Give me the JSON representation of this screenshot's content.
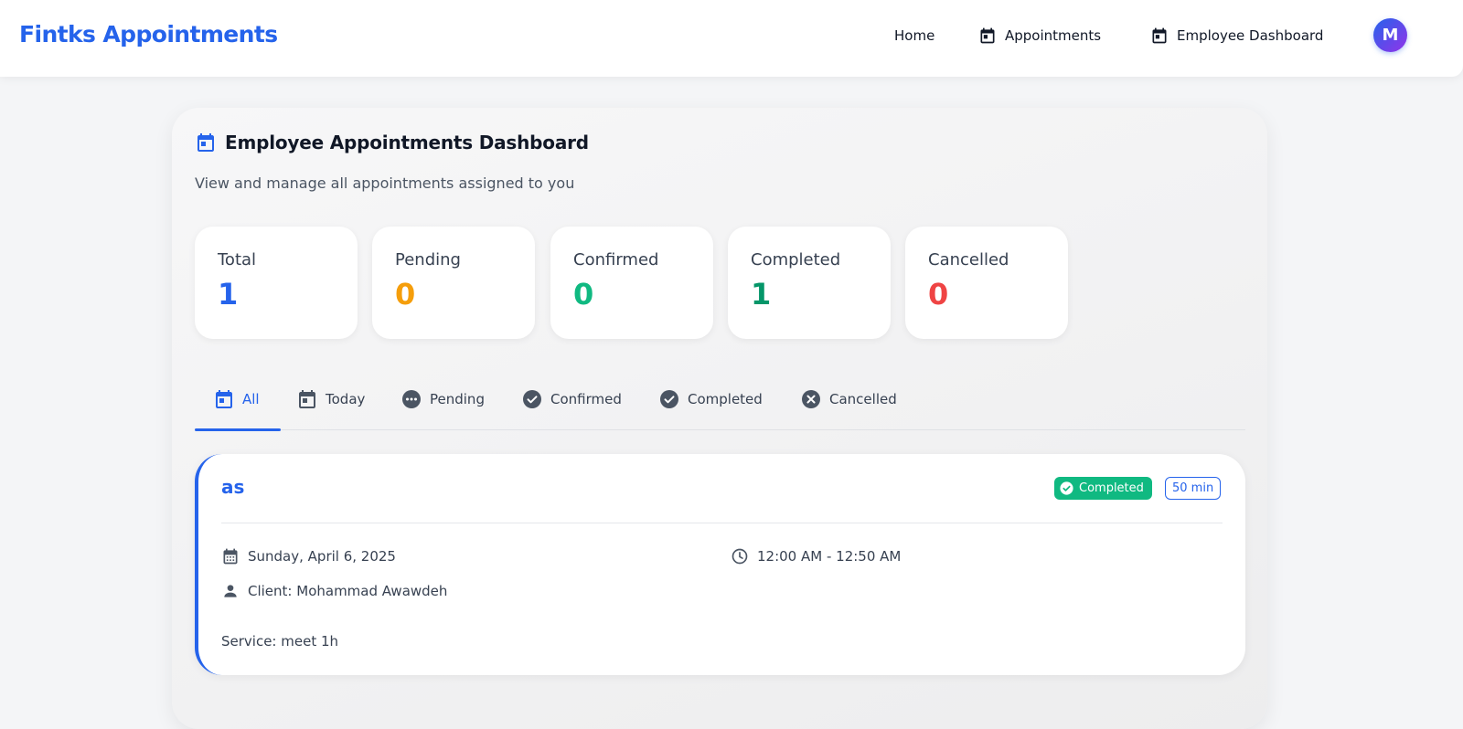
{
  "app": {
    "brand": "Fintks Appointments"
  },
  "nav": {
    "home": "Home",
    "appointments": "Appointments",
    "employee_dashboard": "Employee Dashboard",
    "avatar_initial": "M"
  },
  "dashboard": {
    "title": "Employee Appointments Dashboard",
    "subtitle": "View and manage all appointments assigned to you"
  },
  "stats": [
    {
      "label": "Total",
      "value": "1",
      "color": "#2563eb"
    },
    {
      "label": "Pending",
      "value": "0",
      "color": "#f59e0b"
    },
    {
      "label": "Confirmed",
      "value": "0",
      "color": "#10b981"
    },
    {
      "label": "Completed",
      "value": "1",
      "color": "#059669"
    },
    {
      "label": "Cancelled",
      "value": "0",
      "color": "#ef4444"
    }
  ],
  "tabs": [
    {
      "label": "All",
      "icon": "calendar-icon",
      "active": true
    },
    {
      "label": "Today",
      "icon": "calendar-today-icon"
    },
    {
      "label": "Pending",
      "icon": "pending-icon"
    },
    {
      "label": "Confirmed",
      "icon": "check-circle-icon"
    },
    {
      "label": "Completed",
      "icon": "check-circle-icon"
    },
    {
      "label": "Cancelled",
      "icon": "cancel-icon"
    }
  ],
  "appointment": {
    "title": "as",
    "status": "Completed",
    "duration": "50 min",
    "date": "Sunday, April 6, 2025",
    "time": "12:00 AM - 12:50 AM",
    "client": "Client: Mohammad Awawdeh",
    "service": "Service: meet 1h"
  },
  "colors": {
    "accent": "#2563eb",
    "success": "#10b981",
    "warning": "#f59e0b",
    "danger": "#ef4444"
  }
}
